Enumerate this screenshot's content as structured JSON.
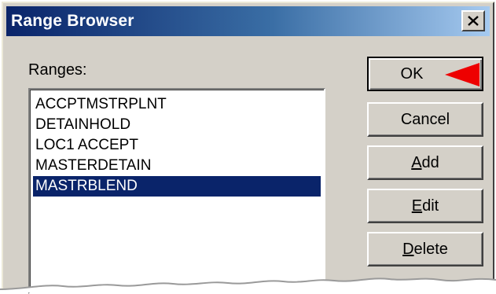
{
  "window": {
    "title": "Range Browser"
  },
  "icons": {
    "close": "close-icon",
    "pointer": "arrow-pointer-icon"
  },
  "ranges": {
    "label": "Ranges:",
    "items": [
      {
        "label": "ACCPTMSTRPLNT",
        "selected": false
      },
      {
        "label": "DETAINHOLD",
        "selected": false
      },
      {
        "label": "LOC1 ACCEPT",
        "selected": false
      },
      {
        "label": "MASTERDETAIN",
        "selected": false
      },
      {
        "label": "MASTRBLEND",
        "selected": true
      }
    ]
  },
  "buttons": {
    "ok": {
      "label": "OK",
      "mnemonic": ""
    },
    "cancel": {
      "label": "Cancel",
      "mnemonic": ""
    },
    "add": {
      "label": "Add",
      "mnemonic": "A"
    },
    "edit": {
      "label": "Edit",
      "mnemonic": "E"
    },
    "delete": {
      "label": "Delete",
      "mnemonic": "D"
    }
  },
  "colors": {
    "titlebar_start": "#0a246a",
    "titlebar_end": "#a6caf0",
    "selection": "#0a246a",
    "face": "#d4d0c8",
    "pointer_arrow": "#ee0000"
  }
}
